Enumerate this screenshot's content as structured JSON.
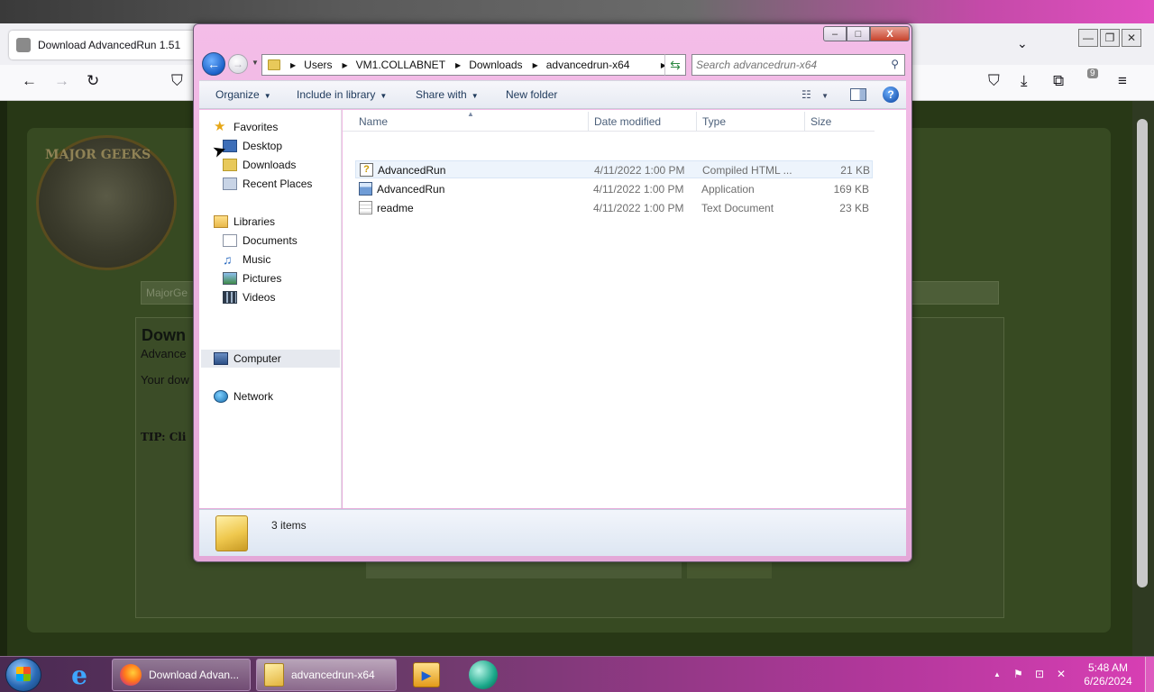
{
  "browser": {
    "tab_title": "Download AdvancedRun 1.51",
    "tab_close": "×",
    "tab_list": "⌄",
    "win_min": "—",
    "win_restore": "❐",
    "win_close": "✕",
    "nav": {
      "back": "←",
      "forward": "→",
      "reload": "↻",
      "shield": "⛉",
      "pocket": "⛉",
      "downloads": "⤓",
      "extensions": "⧉",
      "addon_badge": "9",
      "menu": "≡"
    }
  },
  "page": {
    "logo_text": "MAJOR GEEKS",
    "search_fragment": "MajorGe",
    "heading": "Down",
    "subheading": "Advance",
    "line": "Your dow",
    "tip": "TIP: Cli"
  },
  "explorer": {
    "title_controls": {
      "min": "–",
      "max": "□",
      "close": "X"
    },
    "breadcrumb": [
      "Users",
      "VM1.COLLABNET",
      "Downloads",
      "advancedrun-x64"
    ],
    "search_placeholder": "Search advancedrun-x64",
    "toolbar": {
      "organize": "Organize",
      "include_in_library": "Include in library",
      "share_with": "Share with",
      "new_folder": "New folder"
    },
    "nav_pane": {
      "favorites": "Favorites",
      "desktop": "Desktop",
      "downloads": "Downloads",
      "recent_places": "Recent Places",
      "libraries": "Libraries",
      "documents": "Documents",
      "music": "Music",
      "pictures": "Pictures",
      "videos": "Videos",
      "computer": "Computer",
      "network": "Network"
    },
    "columns": {
      "name": "Name",
      "date": "Date modified",
      "type": "Type",
      "size": "Size"
    },
    "files": [
      {
        "name": "AdvancedRun",
        "date": "4/11/2022 1:00 PM",
        "type": "Compiled HTML ...",
        "size": "21 KB",
        "icon": "chm-help-icon"
      },
      {
        "name": "AdvancedRun",
        "date": "4/11/2022 1:00 PM",
        "type": "Application",
        "size": "169 KB",
        "icon": "application-icon"
      },
      {
        "name": "readme",
        "date": "4/11/2022 1:00 PM",
        "type": "Text Document",
        "size": "23 KB",
        "icon": "text-document-icon"
      }
    ],
    "status": "3 items"
  },
  "taskbar": {
    "firefox_label": "Download Advan...",
    "explorer_label": "advancedrun-x64",
    "time": "5:48 AM",
    "date": "6/26/2024"
  }
}
